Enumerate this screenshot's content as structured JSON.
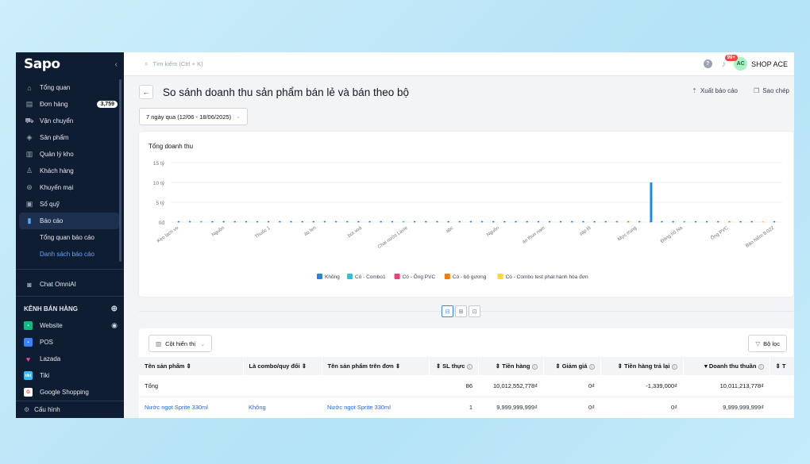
{
  "sidebar": {
    "logo": "Sapo",
    "collapse_icon": "chevron-left-icon",
    "items": [
      {
        "label": "Tổng quan",
        "icon": "home-icon",
        "glyph": "⌂"
      },
      {
        "label": "Đơn hàng",
        "icon": "orders-icon",
        "glyph": "▤",
        "badge": "3,759"
      },
      {
        "label": "Vận chuyển",
        "icon": "truck-icon",
        "glyph": "⛟"
      },
      {
        "label": "Sản phẩm",
        "icon": "box-icon",
        "glyph": "◈"
      },
      {
        "label": "Quản lý kho",
        "icon": "warehouse-icon",
        "glyph": "▥"
      },
      {
        "label": "Khách hàng",
        "icon": "user-icon",
        "glyph": "♙"
      },
      {
        "label": "Khuyến mại",
        "icon": "discount-icon",
        "glyph": "⊛"
      },
      {
        "label": "Sổ quỹ",
        "icon": "cashbook-icon",
        "glyph": "▣"
      },
      {
        "label": "Báo cáo",
        "icon": "report-icon",
        "glyph": "▮"
      }
    ],
    "report_sub": [
      "Tổng quan báo cáo",
      "Danh sách báo cáo"
    ],
    "chat": "Chat OmniAI",
    "channels_title": "KÊNH BÁN HÀNG",
    "channels": [
      {
        "label": "Website",
        "color": "#10b981",
        "glyph": "▪"
      },
      {
        "label": "POS",
        "color": "#3b82f6",
        "glyph": "▪"
      },
      {
        "label": "Lazada",
        "color": "#ec4899",
        "glyph": "♥"
      },
      {
        "label": "Tiki",
        "color": "#38bdf8",
        "glyph": "tiki"
      },
      {
        "label": "Google Shopping",
        "color": "#f59e0b",
        "glyph": "G"
      }
    ],
    "config": "Cấu hình"
  },
  "topbar": {
    "search_placeholder": "Tìm kiếm (Ctrl + K)",
    "notif_badge": "99+",
    "avatar": "AC",
    "shop": "SHOP ACE"
  },
  "page": {
    "title": "So sánh doanh thu sản phẩm bán lẻ và bán theo bộ",
    "export": "Xuất báo cáo",
    "copy": "Sao chép",
    "date_range": "7 ngày qua (12/06 - 18/06/2025)"
  },
  "chart_data": {
    "type": "bar",
    "title": "Tổng doanh thu",
    "ylabel": "",
    "ylim": [
      0,
      15
    ],
    "yticks": [
      "15 tỷ",
      "10 tỷ",
      "5 tỷ",
      "0đ"
    ],
    "ytick_values": [
      15,
      10,
      5,
      0
    ],
    "unit": "tỷ",
    "grid": true,
    "legend_position": "bottom",
    "categories": [
      "Kẹo lạch vo",
      "Nguồn",
      "Thuốc 1",
      "áo len",
      "bút xoá",
      "Chai nước Lavie",
      "abc",
      "Nguồn",
      "áo thun nam",
      "sạp lô",
      "Mực trung",
      "Đông hồ Na",
      "Ống PVC",
      "Bảo hiểm 8.022"
    ],
    "series": [
      {
        "name": "Không",
        "color": "#1e88e5"
      },
      {
        "name": "Có - Combo1",
        "color": "#26c6da"
      },
      {
        "name": "Có - Ống PVC",
        "color": "#ec407a"
      },
      {
        "name": "Có - bộ gương",
        "color": "#f57c00"
      },
      {
        "name": "Có - Combo test phát hành hóa đơn",
        "color": "#fdd835"
      }
    ],
    "highlight": {
      "category": "Mực trung",
      "series": "Không",
      "value": 10.0
    }
  },
  "view_toggle_icons": [
    "split-view-icon",
    "table-view-icon",
    "chart-view-icon"
  ],
  "table": {
    "columns_button": "Cột hiển thị",
    "filter_button": "Bộ lọc",
    "headers": [
      "Tên sản phẩm ⇕",
      "Là combo/quy đổi ⇕",
      "Tên sản phẩm trên đơn ⇕",
      "⇕ SL thực",
      "⇕ Tiền hàng",
      "⇕ Giảm giá",
      "⇕ Tiền hàng trả lại",
      "▾ Doanh thu thuần",
      "⇕ T"
    ],
    "total_row": [
      "Tổng",
      "",
      "",
      "86",
      "10,012,552,778₫",
      "0₫",
      "-1,339,000₫",
      "10,011,213,778₫",
      ""
    ],
    "rows": [
      [
        "Nước ngọt Sprite 330ml",
        "Không",
        "Nước ngọt Sprite 330ml",
        "1",
        "9,999,999,999₫",
        "0₫",
        "0₫",
        "9,999,999,999₫",
        ""
      ]
    ]
  }
}
